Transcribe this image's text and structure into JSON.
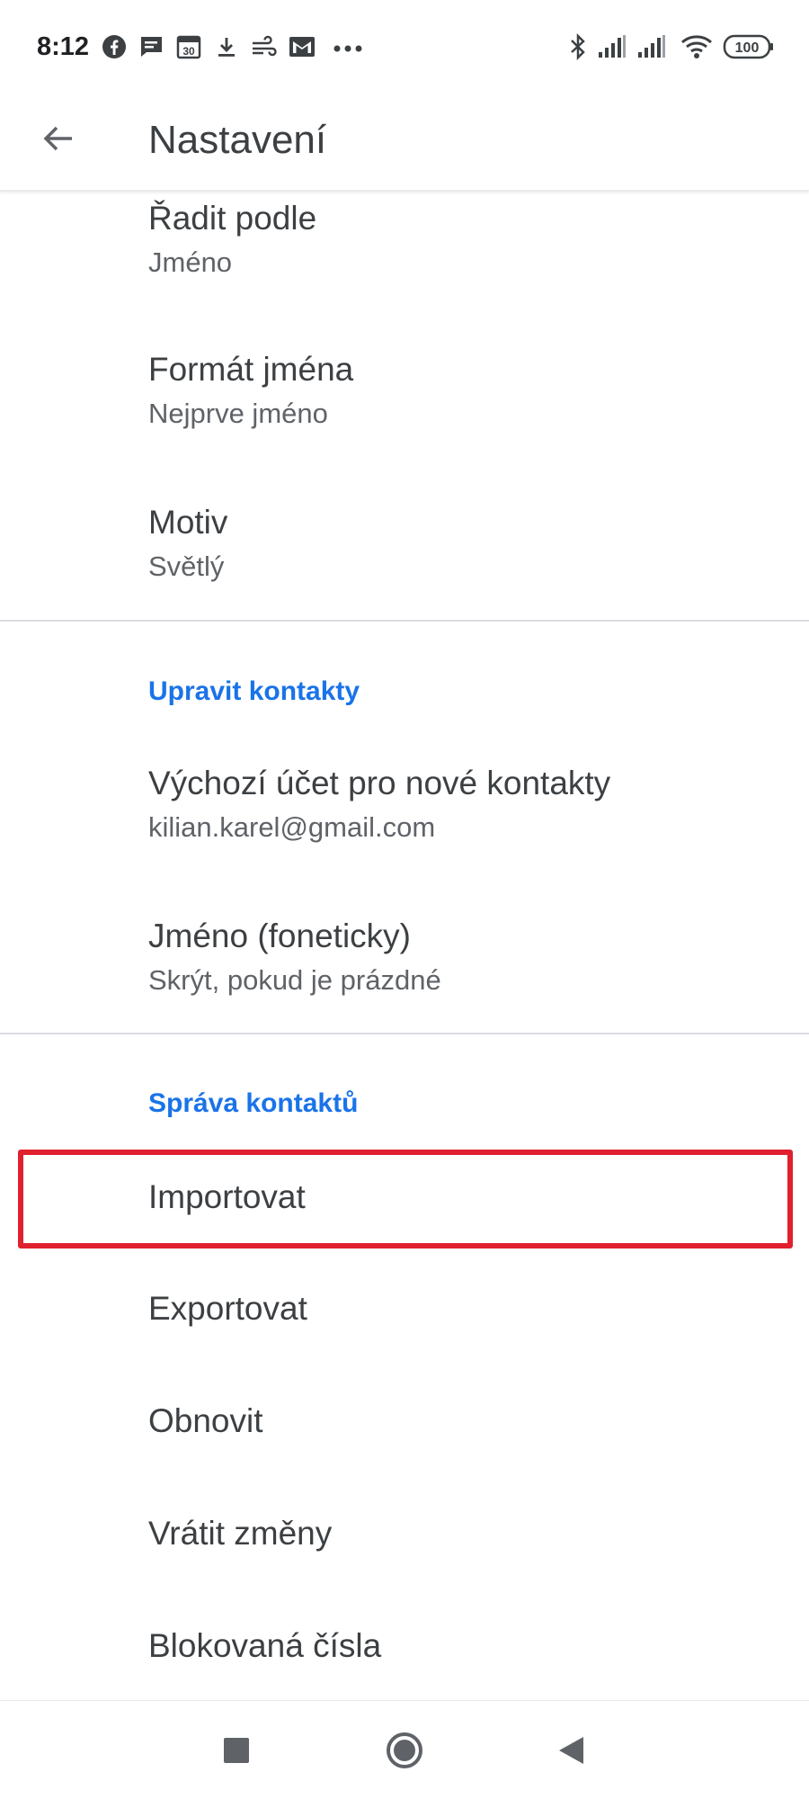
{
  "status_bar": {
    "time": "8:12",
    "notification_icons": [
      "facebook-icon",
      "message-icon",
      "calendar-icon",
      "download-icon",
      "wind-icon",
      "gmail-icon",
      "more-dots-icon"
    ],
    "calendar_day": "30",
    "right_icons": [
      "bluetooth-icon",
      "signal-icon",
      "signal-icon",
      "wifi-icon",
      "battery-icon"
    ],
    "battery": "100"
  },
  "app_bar": {
    "back_icon": "arrow-back-icon",
    "title": "Nastavení"
  },
  "display_items": [
    {
      "title": "Řadit podle",
      "subtitle": "Jméno"
    },
    {
      "title": "Formát jména",
      "subtitle": "Nejprve jméno"
    },
    {
      "title": "Motiv",
      "subtitle": "Světlý"
    }
  ],
  "edit_section": {
    "header": "Upravit kontakty",
    "items": [
      {
        "title": "Výchozí účet pro nové kontakty",
        "subtitle": "kilian.karel@gmail.com"
      },
      {
        "title": "Jméno (foneticky)",
        "subtitle": "Skrýt, pokud je prázdné"
      }
    ]
  },
  "manage_section": {
    "header": "Správa kontaktů",
    "items": [
      {
        "title": "Importovat"
      },
      {
        "title": "Exportovat"
      },
      {
        "title": "Obnovit"
      },
      {
        "title": "Vrátit změny"
      },
      {
        "title": "Blokovaná čísla"
      }
    ]
  },
  "highlight_color": "#e0202e",
  "accent_color": "#1a73e8",
  "nav_bar": {
    "buttons": [
      "recents-square-icon",
      "home-circle-icon",
      "back-triangle-icon"
    ]
  }
}
